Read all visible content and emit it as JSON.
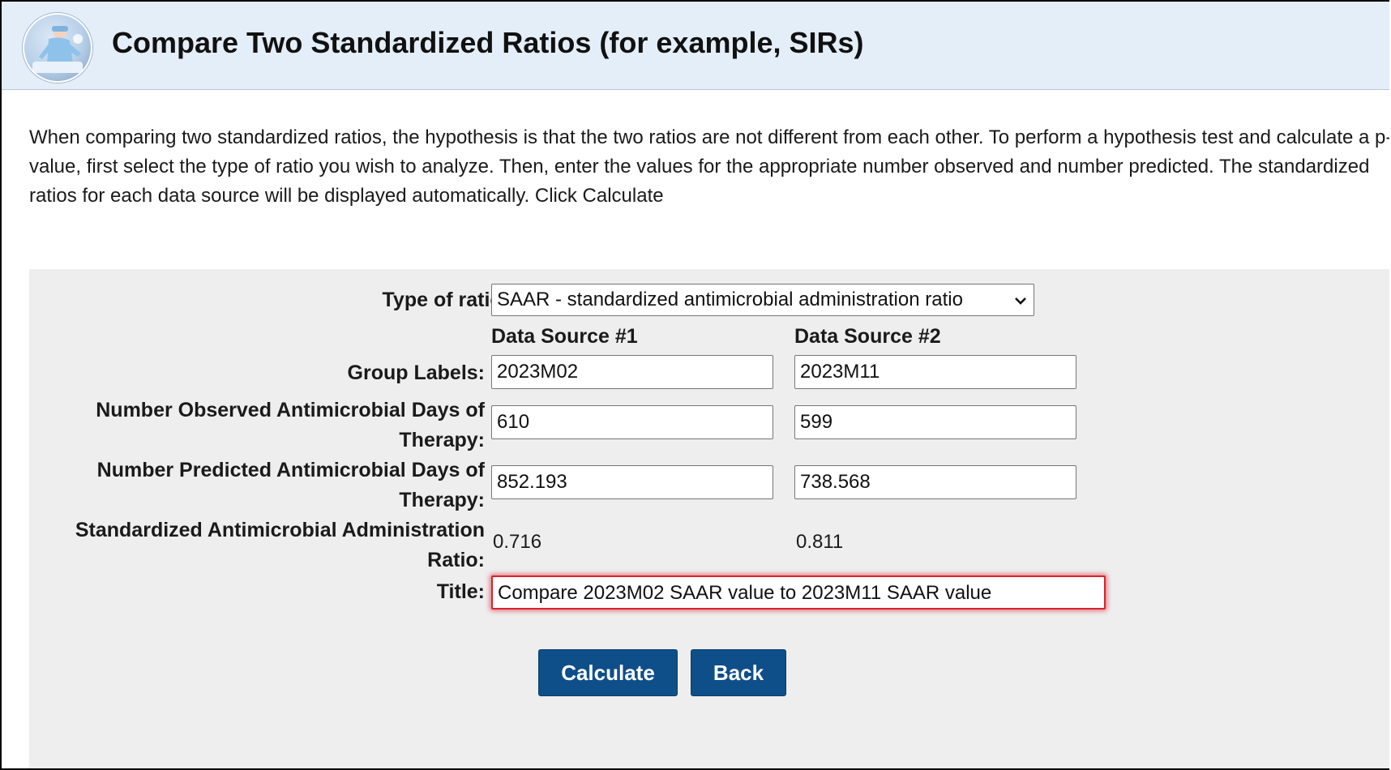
{
  "header": {
    "title": "Compare Two Standardized Ratios (for example, SIRs)"
  },
  "intro": {
    "text": "When comparing two standardized ratios, the hypothesis is that the two ratios are not different from each other. To perform a hypothesis test and calculate a p-value, first select the type of ratio you wish to analyze. Then, enter the values for the appropriate number observed and number predicted. The standardized ratios for each data source will be displayed automatically. Click Calculate"
  },
  "form": {
    "type_of_ratio_label": "Type of ratio:",
    "type_of_ratio_value": "SAAR - standardized antimicrobial administration ratio",
    "column_headers": [
      "Data Source #1",
      "Data Source #2"
    ],
    "group_labels_label": "Group Labels:",
    "group_labels": [
      "2023M02",
      "2023M11"
    ],
    "observed_label": "Number Observed Antimicrobial Days of Therapy:",
    "observed": [
      "610",
      "599"
    ],
    "predicted_label": "Number Predicted Antimicrobial Days of Therapy:",
    "predicted": [
      "852.193",
      "738.568"
    ],
    "ratio_label": "Standardized Antimicrobial Administration Ratio:",
    "ratio": [
      "0.716",
      "0.811"
    ],
    "title_label": "Title:",
    "title_value": "Compare 2023M02 SAAR value to 2023M11 SAAR value"
  },
  "buttons": {
    "calculate": "Calculate",
    "back": "Back"
  },
  "colors": {
    "header_bg": "#e4eef9",
    "panel_bg": "#eeeeee",
    "button_bg": "#0e4f8a",
    "highlight": "#d9232b"
  },
  "icons": {
    "logo": "health-worker-logo-icon",
    "select_arrow": "chevron-down-icon"
  }
}
